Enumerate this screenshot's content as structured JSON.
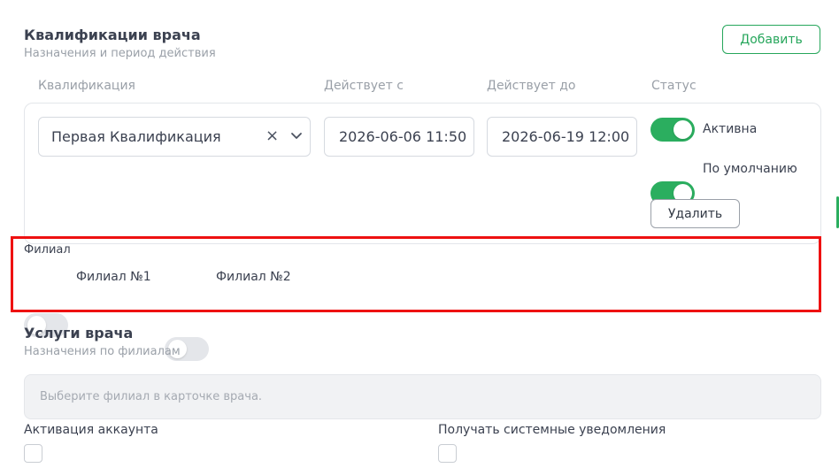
{
  "qualifications": {
    "title": "Квалификации врача",
    "subtitle": "Назначения и период действия",
    "add_label": "Добавить",
    "columns": {
      "qualification": "Квалификация",
      "from": "Действует с",
      "to": "Действует до",
      "status": "Статус"
    },
    "row": {
      "qualification_value": "Первая Квалификация",
      "clear_symbol": "×",
      "from_value": "2026-06-06 11:50",
      "to_value": "2026-06-19 12:00",
      "active_label": "Активна",
      "active_on": true,
      "default_label": "По умолчанию",
      "default_on": true,
      "delete_label": "Удалить"
    }
  },
  "branch": {
    "label": "Филиал",
    "items": [
      {
        "label": "Филиал №1",
        "on": false
      },
      {
        "label": "Филиал №2",
        "on": false
      }
    ]
  },
  "services": {
    "title": "Услуги врача",
    "subtitle": "Назначения по филиалам",
    "notice": "Выберите филиал в карточке врача."
  },
  "account": {
    "activation_label": "Активация аккаунта",
    "activation_checked": false,
    "notifications_label": "Получать системные уведомления",
    "notifications_checked": false
  },
  "colors": {
    "accent": "#2bae5f",
    "highlight": "#ee1111"
  }
}
